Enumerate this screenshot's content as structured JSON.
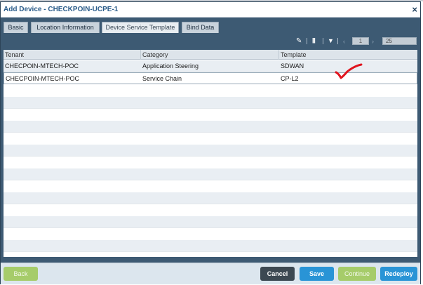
{
  "dialog": {
    "title": "Add Device - CHECKPOIN-UCPE-1",
    "close_icon": "×"
  },
  "tabs": [
    {
      "label": "Basic"
    },
    {
      "label": "Location Information"
    },
    {
      "label": "Device Service Template",
      "active": true
    },
    {
      "label": "Bind Data"
    }
  ],
  "toolbar": {
    "edit_icon": "✎",
    "columns_icon": "|||",
    "filter_icon": "▼",
    "pager_prev": "‹",
    "page_number": "1",
    "pager_next": "›",
    "page_size": "25"
  },
  "table": {
    "columns": [
      "Tenant",
      "Category",
      "Template"
    ],
    "rows": [
      {
        "tenant": "CHECPOIN-MTECH-POC",
        "category": "Application Steering",
        "template": "SDWAN"
      },
      {
        "tenant": "CHECPOIN-MTECH-POC",
        "category": "Service Chain",
        "template": "CP-L2"
      }
    ]
  },
  "annotation": {
    "checkmark_color": "#e0141e"
  },
  "footer": {
    "back": "Back",
    "cancel": "Cancel",
    "save": "Save",
    "continue": "Continue",
    "redeploy": "Redeploy"
  }
}
